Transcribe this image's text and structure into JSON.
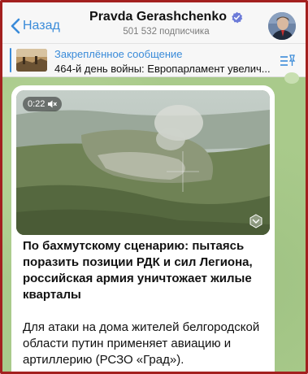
{
  "header": {
    "back_label": "Назад",
    "channel_name": "Pravda Gerashchenko",
    "subscribers": "501 532 подписчика"
  },
  "pinned": {
    "label": "Закреплённое сообщение",
    "text": "464-й день войны: Европарламент увелич..."
  },
  "message": {
    "video_duration": "0:22",
    "headline": "По бахмутскому сценарию: пытаясь поразить позиции РДК и сил Легиона, российская армия уничтожает жилые кварталы",
    "body": "Для атаки на дома жителей белгородской области путин применяет авиацию и артиллерию (РСЗО «Град»)."
  },
  "colors": {
    "accent": "#3a8bd9",
    "frame_border": "#a3201f",
    "wallpaper": "#a9ca8b"
  },
  "icons": [
    "chevron-left-icon",
    "verified-badge-icon",
    "pin-list-icon",
    "muted-speaker-icon",
    "video-corner-icon"
  ]
}
